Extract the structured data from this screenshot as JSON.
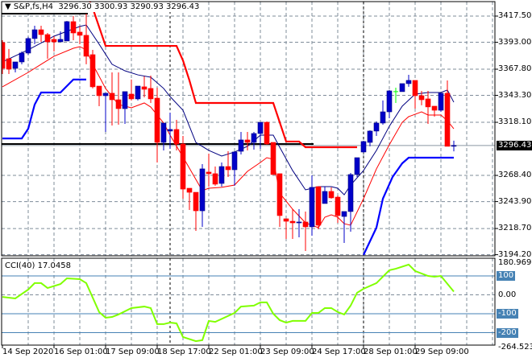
{
  "header": {
    "symbol": "S&P,fs,H4",
    "open": "3296.30",
    "high": "3300.93",
    "low": "3290.93",
    "close": "3296.43"
  },
  "colors": {
    "bull": "#0000c8",
    "bull_outline": "#000080",
    "bear": "#ff0000",
    "doji": "#00ff00",
    "fast_ma": "#000080",
    "slow_ma": "#ff0000",
    "upper_band": "#ff0000",
    "lower_band": "#0000ff",
    "cci": "#80ff00",
    "cci_levels": "#4682b4",
    "grid": "#7f8c9a"
  },
  "chart_data": [
    {
      "type": "candlestick",
      "title": "S&P,fs,H4",
      "ylim": [
        3194.2,
        3417.5
      ],
      "y_ticks": [
        "3417.50",
        "3393.00",
        "3367.80",
        "3343.30",
        "3318.10",
        "3268.40",
        "3243.90",
        "3218.70",
        "3194.20"
      ],
      "y_tick_values": [
        3417.5,
        3393.0,
        3367.8,
        3343.3,
        3318.1,
        3268.4,
        3243.9,
        3218.7,
        3194.2
      ],
      "current_price_label": "3296.43",
      "current_price": 3296.43,
      "x_ticks": [
        {
          "index": 0,
          "label": "14 Sep 2020"
        },
        {
          "index": 8,
          "label": "16 Sep 01:00"
        },
        {
          "index": 16,
          "label": "17 Sep 09:00"
        },
        {
          "index": 24,
          "label": "18 Sep 17:00"
        },
        {
          "index": 32,
          "label": "22 Sep 01:00"
        },
        {
          "index": 40,
          "label": "23 Sep 09:00"
        },
        {
          "index": 48,
          "label": "24 Sep 17:00"
        },
        {
          "index": 56,
          "label": "28 Sep 01:00"
        },
        {
          "index": 64,
          "label": "29 Sep 09:00"
        }
      ],
      "candles_ohlc": [
        [
          3392.7,
          3394.9,
          3363.3,
          3368.6
        ],
        [
          3377.6,
          3386.7,
          3363.3,
          3367.8
        ],
        [
          3368.6,
          3374.6,
          3364.8,
          3374.6
        ],
        [
          3374.6,
          3384.4,
          3372.4,
          3382.9
        ],
        [
          3382.9,
          3398.0,
          3381.4,
          3396.5
        ],
        [
          3396.5,
          3408.5,
          3391.2,
          3404.7
        ],
        [
          3404.7,
          3408.5,
          3393.4,
          3400.2
        ],
        [
          3400.2,
          3401.7,
          3377.6,
          3393.4
        ],
        [
          3395.7,
          3398.7,
          3384.4,
          3393.4
        ],
        [
          3393.4,
          3403.2,
          3393.4,
          3395.7
        ],
        [
          3394.2,
          3413.0,
          3394.2,
          3412.3
        ],
        [
          3412.3,
          3417.5,
          3394.9,
          3401.7
        ],
        [
          3402.5,
          3407.8,
          3391.2,
          3399.5
        ],
        [
          3399.5,
          3419.8,
          3372.4,
          3379.9
        ],
        [
          3381.4,
          3385.9,
          3349.8,
          3351.3
        ],
        [
          3352.0,
          3352.0,
          3333.2,
          3343.0
        ],
        [
          3343.0,
          3345.3,
          3309.1,
          3345.3
        ],
        [
          3345.3,
          3364.8,
          3315.1,
          3339.2
        ],
        [
          3339.2,
          3364.8,
          3315.9,
          3330.9
        ],
        [
          3330.9,
          3346.8,
          3316.6,
          3346.8
        ],
        [
          3344.5,
          3358.1,
          3338.5,
          3340.0
        ],
        [
          3340.0,
          3352.0,
          3338.5,
          3352.0
        ],
        [
          3351.3,
          3361.1,
          3341.5,
          3349.0
        ],
        [
          3349.8,
          3361.8,
          3336.2,
          3340.0
        ],
        [
          3340.7,
          3350.5,
          3280.5,
          3299.3
        ],
        [
          3299.3,
          3317.4,
          3291.8,
          3317.4
        ],
        [
          3309.9,
          3327.2,
          3293.3,
          3311.4
        ],
        [
          3311.4,
          3320.4,
          3291.8,
          3297.8
        ],
        [
          3297.8,
          3305.3,
          3246.6,
          3255.6
        ],
        [
          3256.4,
          3256.4,
          3236.1,
          3252.6
        ],
        [
          3252.6,
          3252.6,
          3216.5,
          3235.3
        ],
        [
          3235.3,
          3279.0,
          3220.3,
          3274.5
        ],
        [
          3271.5,
          3288.8,
          3257.9,
          3270.0
        ],
        [
          3270.0,
          3276.7,
          3258.7,
          3260.2
        ],
        [
          3260.9,
          3280.5,
          3257.9,
          3276.7
        ],
        [
          3276.7,
          3291.0,
          3266.9,
          3273.7
        ],
        [
          3273.7,
          3291.0,
          3258.7,
          3290.3
        ],
        [
          3291.0,
          3309.1,
          3288.0,
          3301.6
        ],
        [
          3301.6,
          3309.1,
          3291.8,
          3299.3
        ],
        [
          3299.3,
          3309.1,
          3292.5,
          3307.6
        ],
        [
          3307.6,
          3318.1,
          3293.3,
          3318.1
        ],
        [
          3318.1,
          3318.9,
          3297.1,
          3297.8
        ],
        [
          3299.3,
          3299.3,
          3269.2,
          3269.2
        ],
        [
          3270.0,
          3270.0,
          3220.3,
          3230.8
        ],
        [
          3227.8,
          3227.8,
          3209.0,
          3225.5
        ],
        [
          3225.5,
          3236.8,
          3209.0,
          3224.0
        ],
        [
          3224.0,
          3236.8,
          3210.5,
          3224.8
        ],
        [
          3224.8,
          3234.6,
          3197.7,
          3220.3
        ],
        [
          3220.3,
          3268.4,
          3212.0,
          3257.2
        ],
        [
          3257.9,
          3257.9,
          3218.0,
          3221.8
        ],
        [
          3242.1,
          3257.9,
          3242.1,
          3253.4
        ],
        [
          3253.4,
          3257.2,
          3246.6,
          3247.4
        ],
        [
          3248.1,
          3249.6,
          3224.0,
          3230.8
        ],
        [
          3230.0,
          3234.6,
          3205.2,
          3234.6
        ],
        [
          3234.6,
          3270.7,
          3215.7,
          3269.2
        ],
        [
          3269.2,
          3285.0,
          3266.9,
          3285.0
        ],
        [
          3290.3,
          3300.8,
          3289.5,
          3300.1
        ],
        [
          3299.3,
          3310.6,
          3295.6,
          3309.9
        ],
        [
          3309.9,
          3318.9,
          3305.3,
          3317.4
        ],
        [
          3317.4,
          3338.5,
          3315.9,
          3327.9
        ],
        [
          3327.9,
          3348.3,
          3321.9,
          3347.5
        ],
        [
          3346.8,
          3350.5,
          3336.2,
          3346.8
        ],
        [
          3346.8,
          3354.3,
          3346.8,
          3354.3
        ],
        [
          3354.3,
          3362.5,
          3351.3,
          3357.3
        ],
        [
          3357.3,
          3357.3,
          3330.9,
          3343.0
        ],
        [
          3343.0,
          3347.5,
          3334.0,
          3339.2
        ],
        [
          3340.0,
          3347.5,
          3316.6,
          3332.5
        ],
        [
          3333.2,
          3333.2,
          3323.4,
          3329.4
        ],
        [
          3329.4,
          3345.3,
          3327.9,
          3345.3
        ],
        [
          3345.3,
          3357.3,
          3295.6,
          3295.6
        ],
        [
          3296.3,
          3300.93,
          3290.93,
          3296.43
        ]
      ],
      "fast_ma": [
        [
          0,
          3374.6
        ],
        [
          4,
          3385.9
        ],
        [
          8,
          3398.7
        ],
        [
          12,
          3407.8
        ],
        [
          13,
          3409.2
        ],
        [
          15,
          3391.2
        ],
        [
          17,
          3372.4
        ],
        [
          19,
          3366.3
        ],
        [
          21,
          3362.5
        ],
        [
          23,
          3360.3
        ],
        [
          25,
          3349.8
        ],
        [
          26,
          3342.2
        ],
        [
          28,
          3329.4
        ],
        [
          30,
          3299.3
        ],
        [
          32,
          3291.8
        ],
        [
          34,
          3286.5
        ],
        [
          36,
          3290.3
        ],
        [
          38,
          3295.6
        ],
        [
          40,
          3306.1
        ],
        [
          42,
          3306.1
        ],
        [
          43,
          3294.8
        ],
        [
          45,
          3273.0
        ],
        [
          47,
          3254.9
        ],
        [
          49,
          3257.9
        ],
        [
          51,
          3257.9
        ],
        [
          52,
          3256.4
        ],
        [
          53,
          3250.3
        ],
        [
          54,
          3259.4
        ],
        [
          56,
          3273.0
        ],
        [
          58,
          3291.8
        ],
        [
          60,
          3314.4
        ],
        [
          62,
          3333.2
        ],
        [
          64,
          3344.5
        ],
        [
          66,
          3346.0
        ],
        [
          68,
          3346.0
        ],
        [
          69,
          3348.3
        ],
        [
          70,
          3336.9
        ]
      ],
      "slow_ma": [
        [
          0,
          3351.3
        ],
        [
          4,
          3364.8
        ],
        [
          6,
          3372.4
        ],
        [
          8,
          3379.9
        ],
        [
          11,
          3387.4
        ],
        [
          12,
          3388.9
        ],
        [
          13,
          3385.9
        ],
        [
          14,
          3372.4
        ],
        [
          16,
          3349.8
        ],
        [
          18,
          3334.7
        ],
        [
          20,
          3331.7
        ],
        [
          22,
          3336.2
        ],
        [
          23,
          3332.4
        ],
        [
          25,
          3317.4
        ],
        [
          26,
          3306.1
        ],
        [
          28,
          3285.7
        ],
        [
          31,
          3254.1
        ],
        [
          32,
          3256.4
        ],
        [
          34,
          3257.2
        ],
        [
          36,
          3259.4
        ],
        [
          38,
          3272.2
        ],
        [
          40,
          3280.5
        ],
        [
          41,
          3285.0
        ],
        [
          42,
          3283.5
        ],
        [
          43,
          3251.8
        ],
        [
          45,
          3236.8
        ],
        [
          47,
          3224.0
        ],
        [
          49,
          3219.5
        ],
        [
          50,
          3229.3
        ],
        [
          51,
          3231.5
        ],
        [
          52,
          3229.3
        ],
        [
          53,
          3223.2
        ],
        [
          54,
          3221.8
        ],
        [
          56,
          3246.6
        ],
        [
          58,
          3274.5
        ],
        [
          60,
          3297.1
        ],
        [
          62,
          3318.1
        ],
        [
          63,
          3323.4
        ],
        [
          64,
          3325.6
        ],
        [
          65,
          3327.9
        ],
        [
          66,
          3324.9
        ],
        [
          68,
          3324.9
        ],
        [
          69,
          3319.6
        ],
        [
          70,
          3312.1
        ]
      ],
      "upper_band": [
        [
          13.5,
          3432.0
        ],
        [
          14,
          3425.0
        ],
        [
          16,
          3389.6
        ],
        [
          27,
          3389.6
        ],
        [
          28,
          3376.0
        ],
        [
          29,
          3357.3
        ],
        [
          30,
          3336.2
        ],
        [
          42,
          3336.2
        ],
        [
          44,
          3300.1
        ],
        [
          46,
          3300.1
        ],
        [
          47,
          3294.8
        ],
        [
          55,
          3294.8
        ]
      ],
      "lower_band_segments": [
        [
          [
            0,
            3303.0
          ],
          [
            3,
            3303.0
          ],
          [
            4,
            3312.1
          ],
          [
            5,
            3334.7
          ],
          [
            6,
            3346.0
          ],
          [
            9,
            3346.0
          ],
          [
            11,
            3358.1
          ],
          [
            13,
            3358.1
          ]
        ],
        [
          [
            56,
            3194.0
          ],
          [
            58,
            3219.5
          ],
          [
            59,
            3246.6
          ],
          [
            60.5,
            3266.9
          ],
          [
            62,
            3279.7
          ],
          [
            63,
            3285.0
          ],
          [
            70,
            3285.0
          ]
        ]
      ],
      "horizontal_lines": [
        {
          "price": 3297.8,
          "from_index": 0,
          "to_index": 48
        },
        {
          "price": 3419.8,
          "from_index": 0,
          "to_index": 13
        }
      ],
      "vertical_lines_index": [
        26,
        56
      ]
    },
    {
      "type": "line",
      "title": "CCI(40) 17.0458",
      "name": "CCI(40)",
      "last_value": "17.0458",
      "ylim": [
        -264.5238,
        180.9695
      ],
      "y_max_label": "180.9695",
      "y_min_label": "-264.5238",
      "zero_label": "0.00",
      "levels": [
        {
          "value": 100,
          "label": "100"
        },
        {
          "value": -100,
          "label": "-100"
        },
        {
          "value": -200,
          "label": "-200"
        }
      ],
      "points": [
        [
          0,
          -11
        ],
        [
          2,
          -19
        ],
        [
          4,
          28
        ],
        [
          5,
          62
        ],
        [
          6,
          62
        ],
        [
          7,
          36
        ],
        [
          9,
          57
        ],
        [
          10,
          87
        ],
        [
          12,
          83
        ],
        [
          13,
          62
        ],
        [
          15,
          -91
        ],
        [
          16,
          -121
        ],
        [
          17,
          -117
        ],
        [
          18,
          -104
        ],
        [
          20,
          -70
        ],
        [
          22,
          -62
        ],
        [
          23,
          -70
        ],
        [
          24,
          -155
        ],
        [
          25,
          -155
        ],
        [
          26,
          -147
        ],
        [
          27,
          -151
        ],
        [
          28,
          -223
        ],
        [
          30,
          -245
        ],
        [
          31,
          -240
        ],
        [
          32,
          -138
        ],
        [
          33,
          -143
        ],
        [
          36,
          -96
        ],
        [
          37,
          -62
        ],
        [
          39,
          -57
        ],
        [
          40,
          -40
        ],
        [
          41,
          -40
        ],
        [
          42,
          -100
        ],
        [
          43,
          -134
        ],
        [
          44,
          -147
        ],
        [
          45,
          -138
        ],
        [
          47,
          -138
        ],
        [
          48,
          -96
        ],
        [
          49,
          -96
        ],
        [
          50,
          -70
        ],
        [
          51,
          -70
        ],
        [
          52,
          -91
        ],
        [
          53,
          -104
        ],
        [
          54,
          -57
        ],
        [
          55,
          11
        ],
        [
          56,
          32
        ],
        [
          58,
          62
        ],
        [
          60,
          130
        ],
        [
          61,
          138
        ],
        [
          63,
          160
        ],
        [
          64,
          126
        ],
        [
          66,
          100
        ],
        [
          67,
          96
        ],
        [
          68,
          100
        ],
        [
          70,
          17
        ]
      ]
    }
  ]
}
